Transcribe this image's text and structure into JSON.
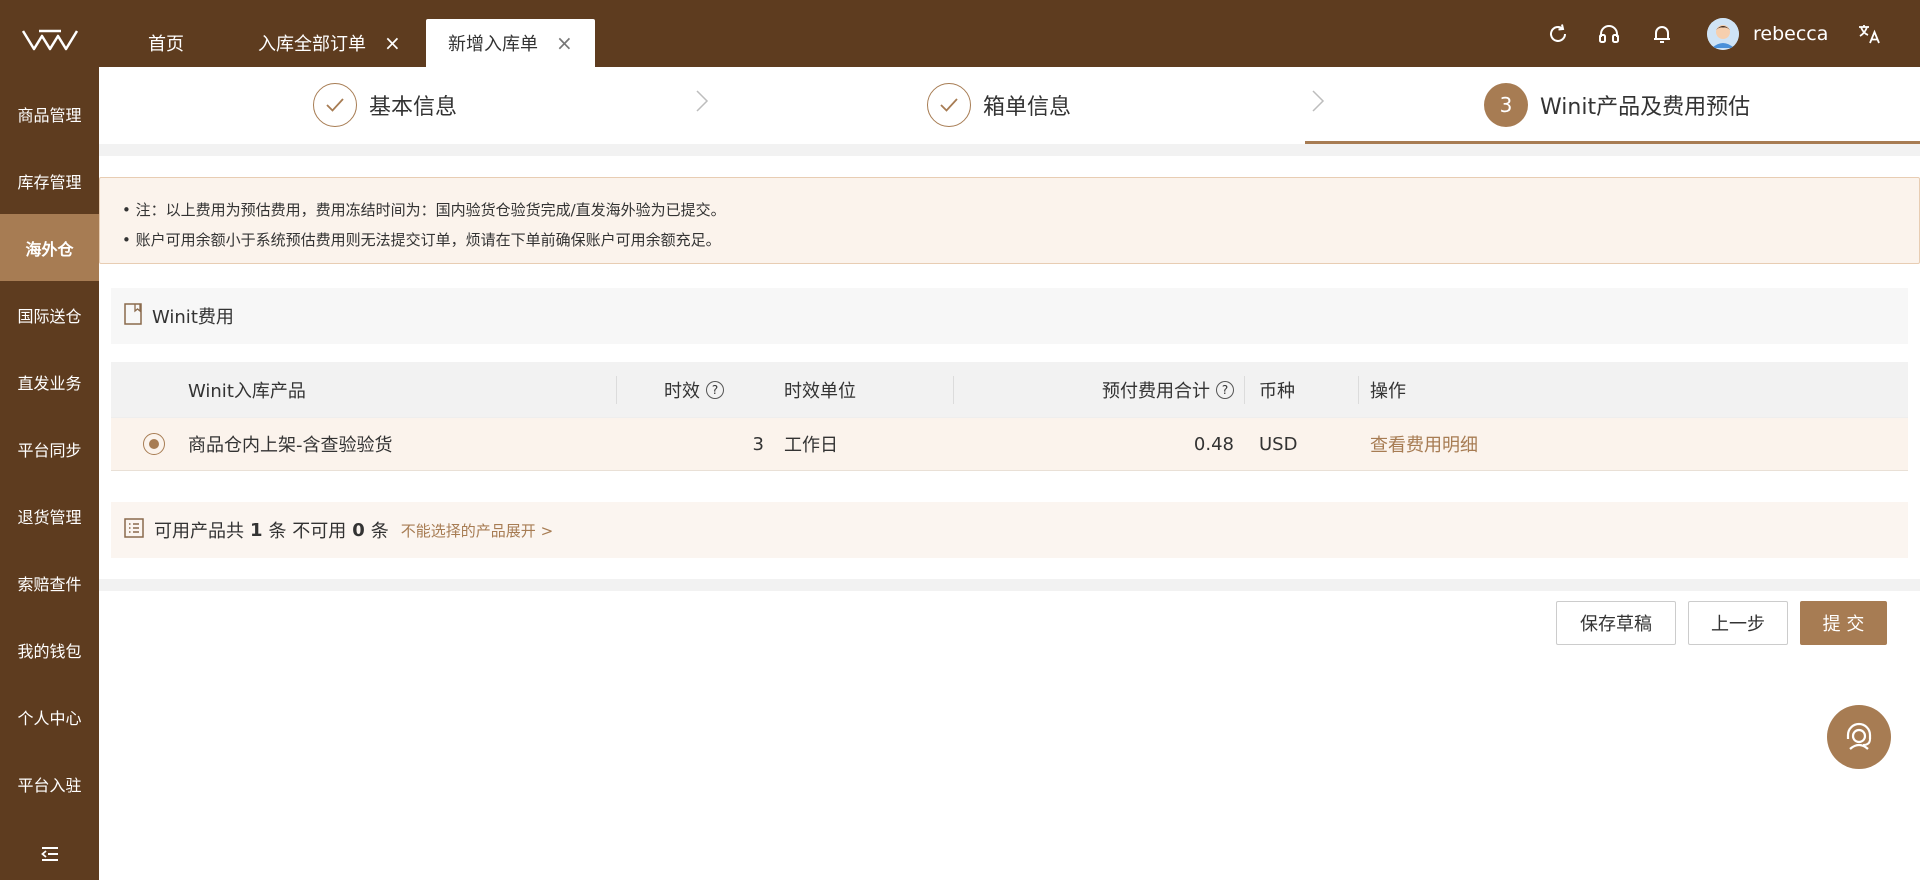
{
  "sidebar": {
    "items": [
      {
        "label": "商品管理"
      },
      {
        "label": "库存管理"
      },
      {
        "label": "海外仓"
      },
      {
        "label": "国际送仓"
      },
      {
        "label": "直发业务"
      },
      {
        "label": "平台同步"
      },
      {
        "label": "退货管理"
      },
      {
        "label": "索赔查件"
      },
      {
        "label": "我的钱包"
      },
      {
        "label": "个人中心"
      },
      {
        "label": "平台入驻"
      }
    ],
    "active_index": 2
  },
  "tabs": [
    {
      "label": "首页"
    },
    {
      "label": "入库全部订单",
      "close": "×"
    },
    {
      "label": "新增入库单",
      "close": "×"
    }
  ],
  "header": {
    "username": "rebecca"
  },
  "steps": [
    {
      "label": "基本信息",
      "status": "done"
    },
    {
      "label": "箱单信息",
      "status": "done"
    },
    {
      "number": "3",
      "label": "Winit产品及费用预估",
      "status": "active"
    }
  ],
  "notice": {
    "lines": [
      "• 注：以上费用为预估费用，费用冻结时间为：国内验货仓验货完成/直发海外验为已提交。",
      "• 账户可用余额小于系统预估费用则无法提交订单，烦请在下单前确保账户可用余额充足。"
    ]
  },
  "fee_panel": {
    "title": "Winit费用"
  },
  "table": {
    "headers": {
      "product": "Winit入库产品",
      "aging": "时效",
      "aging_unit": "时效单位",
      "fee_total": "预付费用合计",
      "currency": "币种",
      "action": "操作"
    },
    "help_glyph": "?",
    "rows": [
      {
        "selected": true,
        "product": "商品仓内上架-含查验验货",
        "aging": "3",
        "aging_unit": "工作日",
        "fee_total": "0.48",
        "currency": "USD",
        "action": "查看费用明细"
      }
    ]
  },
  "summary": {
    "prefix": "可用产品共",
    "available": "1",
    "mid": "条 不可用",
    "unavailable": "0",
    "suffix": "条",
    "expand_link": "不能选择的产品展开 >"
  },
  "buttons": {
    "save_draft": "保存草稿",
    "previous": "上一步",
    "submit": "提 交"
  },
  "colors": {
    "sidebar_bg": "#5e3c1f",
    "accent": "#a77c53",
    "notice_bg": "#fbf3ec"
  }
}
